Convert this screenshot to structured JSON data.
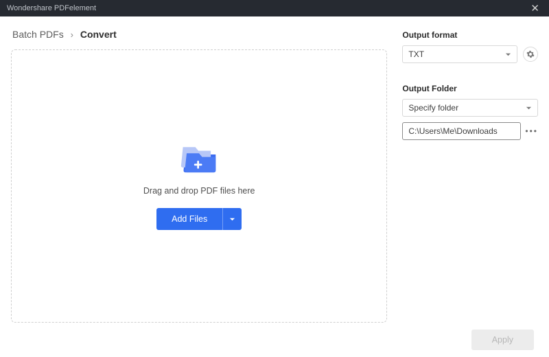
{
  "titlebar": {
    "title": "Wondershare PDFelement"
  },
  "breadcrumb": {
    "root": "Batch PDFs",
    "current": "Convert"
  },
  "dropzone": {
    "hint": "Drag and drop PDF files here",
    "add_label": "Add Files"
  },
  "output_format": {
    "label": "Output format",
    "value": "TXT"
  },
  "output_folder": {
    "label": "Output Folder",
    "mode": "Specify folder",
    "path": "C:\\Users\\Me\\Downloads"
  },
  "footer": {
    "apply_label": "Apply"
  }
}
